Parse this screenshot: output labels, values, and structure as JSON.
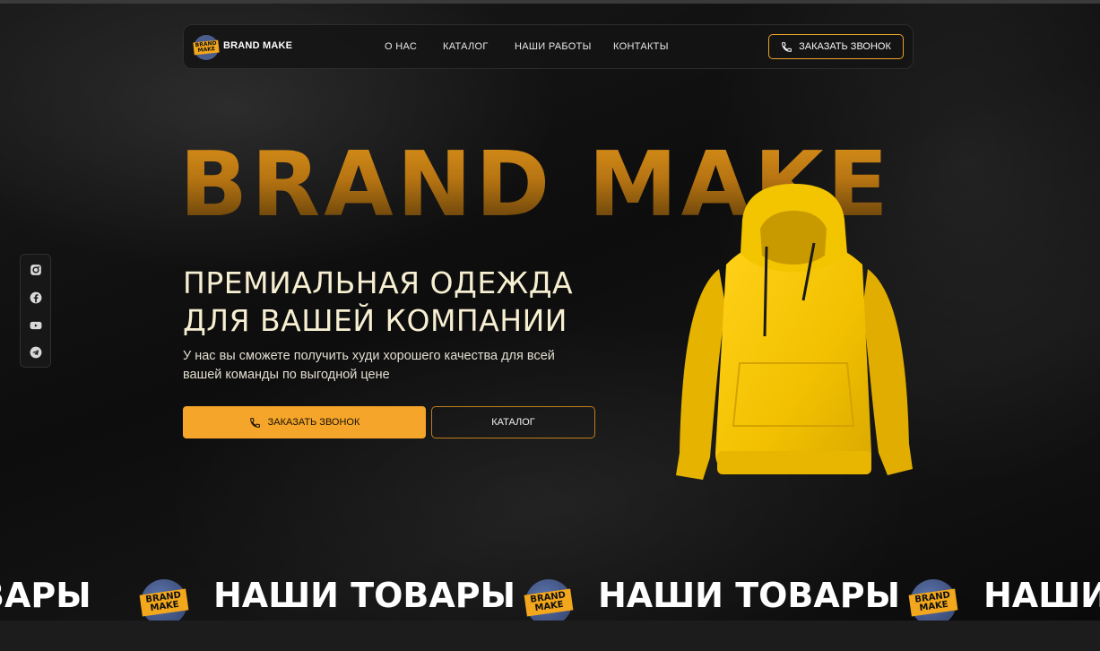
{
  "nav": {
    "logo_text": "BRAND MAKE",
    "brand_name": "BRAND MAKE",
    "links": [
      "О НАС",
      "КАТАЛОГ",
      "НАШИ РАБОТЫ",
      "КОНТАКТЫ"
    ],
    "call_button": "ЗАКАЗАТЬ ЗВОНОК"
  },
  "social": [
    "instagram-icon",
    "facebook-icon",
    "youtube-icon",
    "telegram-icon"
  ],
  "hero": {
    "big_title": "BRAND MAKE",
    "headline_line1": "ПРЕМИАЛЬНАЯ ОДЕЖДА",
    "headline_line2": "ДЛЯ ВАШЕЙ КОМПАНИИ",
    "subtext": "У нас вы сможете получить худи хорошего качества для всей вашей команды по выгодной цене",
    "primary_button": "ЗАКАЗАТЬ ЗВОНОК",
    "secondary_button": "КАТАЛОГ"
  },
  "marquee": {
    "item_text": "НАШИ ТОВАРЫ",
    "partial_left": "ВАРЫ",
    "partial_right": "НАШИ",
    "logo_text": "BRAND MAKE"
  },
  "colors": {
    "accent": "#f4a52a",
    "hoodie": "#f5c400",
    "background": "#0d0d0d"
  }
}
